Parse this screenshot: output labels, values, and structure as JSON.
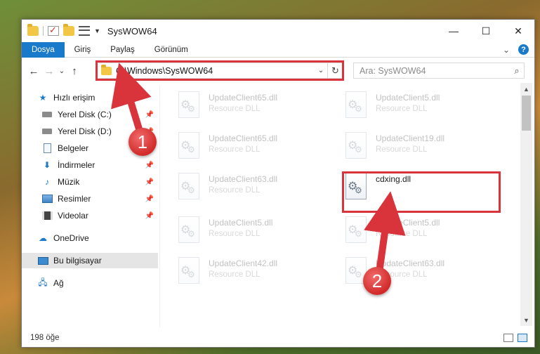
{
  "window": {
    "title": "SysWOW64",
    "controls": {
      "minimize": "—",
      "maximize": "☐",
      "close": "✕"
    }
  },
  "ribbon": {
    "tabs": [
      "Dosya",
      "Giriş",
      "Paylaş",
      "Görünüm"
    ],
    "expand": "⌄",
    "help": "?"
  },
  "nav": {
    "back": "←",
    "forward": "→",
    "recent": "⌄",
    "up": "↑",
    "address": "C:\\Windows\\SysWOW64",
    "search_placeholder": "Ara: SysWOW64"
  },
  "sidebar": {
    "items": [
      {
        "label": "Hızlı erişim",
        "icon": "star-icon",
        "pinned": false
      },
      {
        "label": "Yerel Disk (C:)",
        "icon": "drive-icon",
        "pinned": true
      },
      {
        "label": "Yerel Disk (D:)",
        "icon": "drive-icon",
        "pinned": true
      },
      {
        "label": "Belgeler",
        "icon": "documents-icon",
        "pinned": true
      },
      {
        "label": "İndirmeler",
        "icon": "downloads-icon",
        "pinned": true
      },
      {
        "label": "Müzik",
        "icon": "music-icon",
        "pinned": true
      },
      {
        "label": "Resimler",
        "icon": "pictures-icon",
        "pinned": true
      },
      {
        "label": "Videolar",
        "icon": "videos-icon",
        "pinned": true
      },
      {
        "label": "OneDrive",
        "icon": "onedrive-icon",
        "pinned": false
      },
      {
        "label": "Bu bilgisayar",
        "icon": "this-pc-icon",
        "pinned": false,
        "selected": true
      },
      {
        "label": "Ağ",
        "icon": "network-icon",
        "pinned": false
      }
    ],
    "pin_glyph": "📌"
  },
  "files": {
    "left": [
      {
        "name": "UpdateClient65.dll",
        "type": "Resource DLL"
      },
      {
        "name": "UpdateClient65.dll",
        "type": "Resource DLL"
      },
      {
        "name": "UpdateClient63.dll",
        "type": "Resource DLL"
      },
      {
        "name": "UpdateClient5.dll",
        "type": "Resource DLL"
      },
      {
        "name": "UpdateClient42.dll",
        "type": "Resource DLL"
      }
    ],
    "right": [
      {
        "name": "UpdateClient5.dll",
        "type": "Resource DLL"
      },
      {
        "name": "UpdateClient19.dll",
        "type": "Resource DLL"
      },
      {
        "name": "cdxing.dll",
        "type": ""
      },
      {
        "name": "UpdateClient5.dll",
        "type": "Resource DLL"
      },
      {
        "name": "UpdateClient63.dll",
        "type": "Resource DLL"
      }
    ]
  },
  "status": {
    "count": "198 öğe"
  },
  "annotations": {
    "step1": "1",
    "step2": "2",
    "color": "#d9333b"
  }
}
